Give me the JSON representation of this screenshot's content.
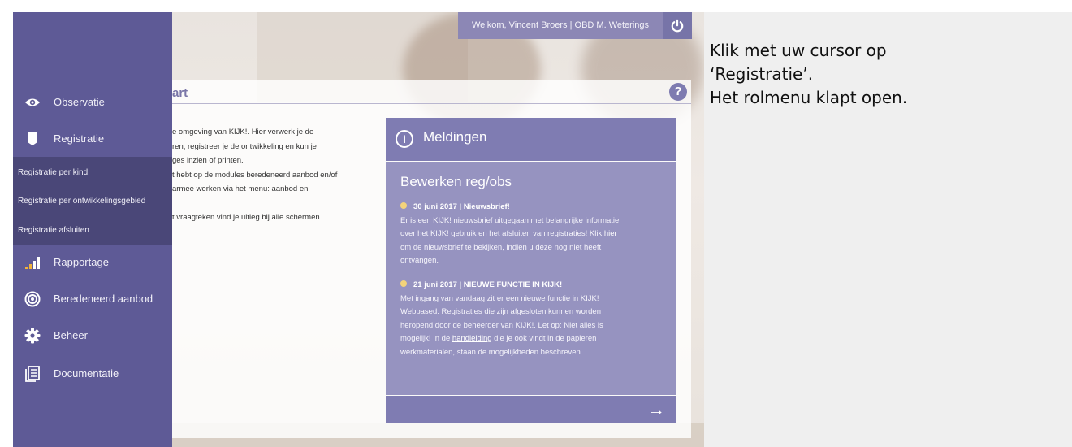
{
  "header": {
    "welcome_text": "Welkom, Vincent Broers | OBD M. Weterings",
    "power_icon": "power-icon"
  },
  "page": {
    "title": "art",
    "help_label": "?",
    "intro_lines": [
      "e omgeving van KIJK!. Hier verwerk je de",
      "ren, registreer je de ontwikkeling en kun je",
      "ges inzien of printen.",
      "t hebt op de modules beredeneerd aanbod en/of",
      "armee werken via het menu: aanbod en",
      "",
      "t vraagteken vind je uitleg bij alle schermen."
    ]
  },
  "sidebar": {
    "items": [
      {
        "label": "Observatie",
        "icon": "eye-icon"
      },
      {
        "label": "Registratie",
        "icon": "bookmark-icon"
      },
      {
        "label": "Rapportage",
        "icon": "bar-chart-icon"
      },
      {
        "label": "Beredeneerd aanbod",
        "icon": "target-icon"
      },
      {
        "label": "Beheer",
        "icon": "gear-icon"
      },
      {
        "label": "Documentatie",
        "icon": "document-icon"
      }
    ],
    "submenu": [
      "Registratie per kind",
      "Registratie per ontwikkelingsgebied",
      "Registratie afsluiten"
    ]
  },
  "meldingen": {
    "title": "Meldingen",
    "info_icon": "info-icon",
    "subtitle": "Bewerken reg/obs",
    "news": [
      {
        "heading": "30 juni 2017 | Nieuwsbrief!",
        "lines": [
          "Er is een KIJK! nieuwsbrief uitgegaan met belangrijke informatie",
          "over het KIJK! gebruik en het afsluiten van registraties! Klik",
          "hier",
          "om de nieuwsbrief te bekijken, indien u deze nog niet heeft",
          "ontvangen."
        ]
      },
      {
        "heading": "21 juni 2017 | NIEUWE FUNCTIE IN KIJK!",
        "lines": [
          "Met ingang van vandaag zit er een nieuwe functie in KIJK!",
          "Webbased: Registraties die zijn afgesloten kunnen worden",
          "heropend door de beheerder van KIJK!. Let op: Niet alles is",
          "mogelijk! In de",
          "handleiding",
          "die je ook vindt in de papieren",
          "werkmaterialen, staan de mogelijkheden beschreven."
        ]
      }
    ],
    "footer_arrow": "→"
  },
  "instructions": {
    "lines": [
      "Klik met uw cursor op",
      "‘Registratie’.",
      "Het rolmenu klapt open."
    ]
  }
}
